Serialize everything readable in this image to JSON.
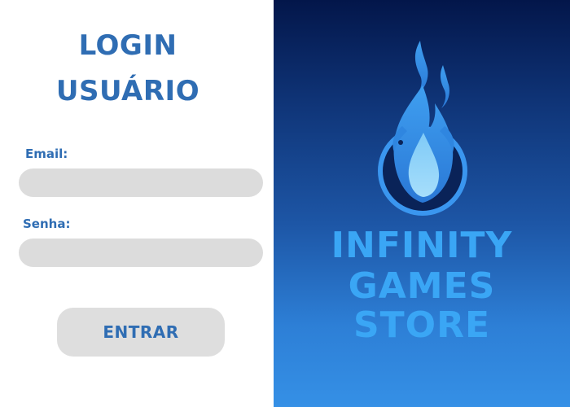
{
  "login_panel": {
    "title_line_1": "LOGIN",
    "title_line_2": "USUÁRIO",
    "email_label": "Email:",
    "email_value": "",
    "password_label": "Senha:",
    "password_value": "",
    "submit_label": "ENTRAR"
  },
  "brand_panel": {
    "logo_icon": "blue-flame-icon",
    "name_line_1": "INFINITY",
    "name_line_2": "GAMES",
    "name_line_3": "STORE"
  },
  "colors": {
    "accent_text": "#2f6db3",
    "brand_text": "#3aa6f5",
    "input_bg": "#dcdcdc",
    "panel_gradient_top": "#03164a",
    "panel_gradient_bottom": "#3590e6"
  }
}
